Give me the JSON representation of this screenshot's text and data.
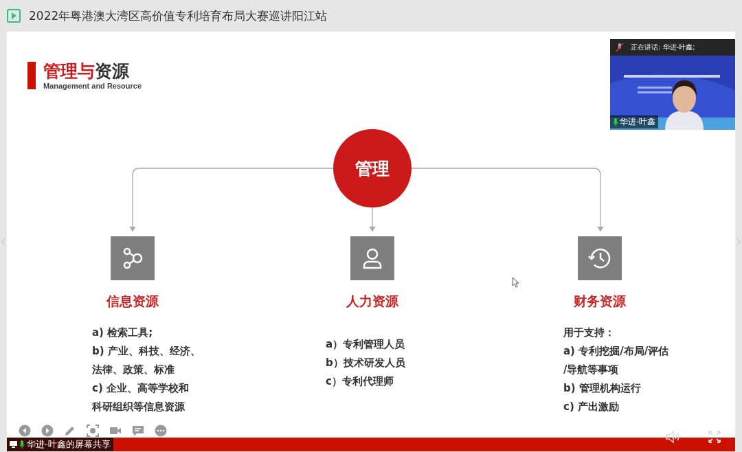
{
  "window": {
    "title": "2022年粤港澳大湾区高价值专利培育布局大赛巡讲阳江站"
  },
  "slide": {
    "title_segments": [
      {
        "text": "管理与",
        "accent": true
      },
      {
        "text": "资源",
        "accent": false
      }
    ],
    "subtitle": "Management and Resource",
    "center": "管理",
    "branches": [
      {
        "kind": "share",
        "heading": "信息资源",
        "lines": [
          "a) 检索工具;",
          "b) 产业、科技、经济、",
          "法律、政策、标准",
          "c) 企业、高等学校和",
          "科研组织等信息资源"
        ]
      },
      {
        "kind": "person",
        "heading": "人力资源",
        "lines": [
          "a）专利管理人员",
          "b）技术研发人员",
          "c）专利代理师"
        ]
      },
      {
        "kind": "history",
        "heading": "财务资源",
        "lines": [
          "用于支持：",
          "a) 专利挖掘/布局/评估",
          "/导航等事项",
          "b) 管理机构运行",
          "c) 产出激励"
        ]
      }
    ]
  },
  "video": {
    "status": "正在讲话: 华进-叶鑫;",
    "name": "华进-叶鑫"
  },
  "share_label": "华进-叶鑫的屏幕共享"
}
